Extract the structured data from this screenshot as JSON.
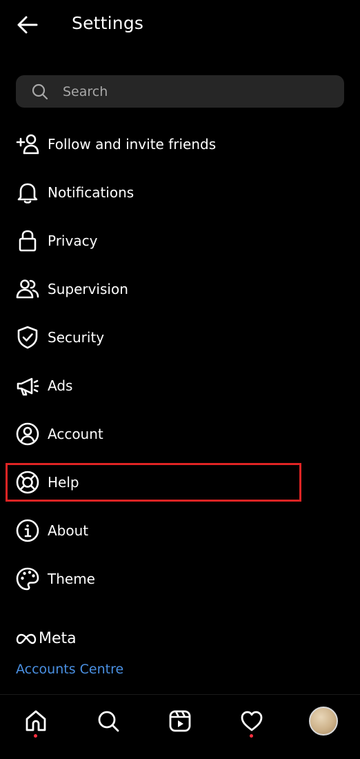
{
  "header": {
    "title": "Settings",
    "back_icon": "arrow-left-icon"
  },
  "search": {
    "placeholder": "Search",
    "value": "",
    "icon": "search-icon"
  },
  "menu": {
    "items": [
      {
        "label": "Follow and invite friends",
        "icon": "add-person-icon"
      },
      {
        "label": "Notifications",
        "icon": "bell-icon"
      },
      {
        "label": "Privacy",
        "icon": "lock-icon"
      },
      {
        "label": "Supervision",
        "icon": "people-icon"
      },
      {
        "label": "Security",
        "icon": "shield-check-icon"
      },
      {
        "label": "Ads",
        "icon": "megaphone-icon"
      },
      {
        "label": "Account",
        "icon": "user-circle-icon"
      },
      {
        "label": "Help",
        "icon": "lifebuoy-icon"
      },
      {
        "label": "About",
        "icon": "info-icon"
      },
      {
        "label": "Theme",
        "icon": "palette-icon"
      }
    ]
  },
  "highlighted_item": "Help",
  "footer": {
    "brand": "Meta",
    "accounts_centre": "Accounts Centre"
  },
  "bottom_nav": {
    "items": [
      "home-icon",
      "search-icon",
      "reels-icon",
      "heart-icon",
      "profile-avatar"
    ]
  },
  "colors": {
    "background": "#000000",
    "search_bg": "#262626",
    "link": "#4a90e2",
    "highlight": "#e02424",
    "notification_dot": "#ff3040"
  }
}
